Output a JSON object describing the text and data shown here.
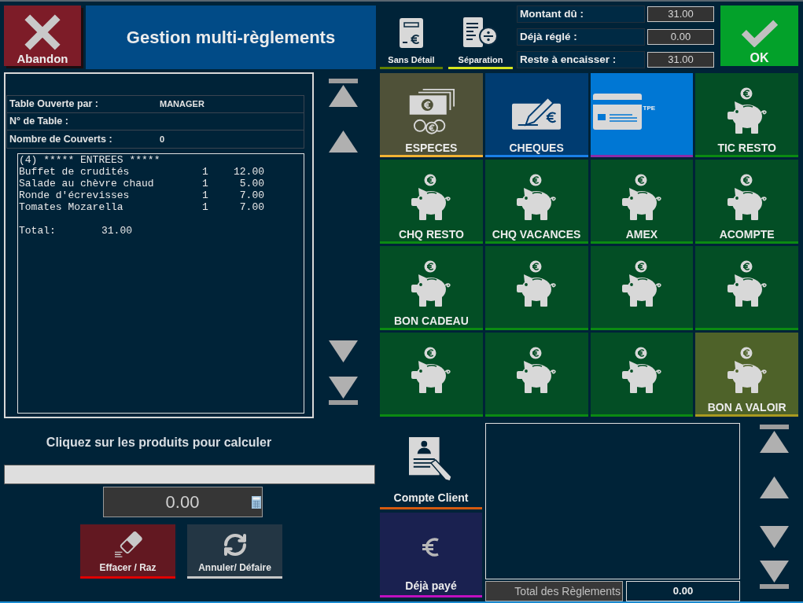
{
  "header": {
    "abandon_label": "Abandon",
    "title": "Gestion multi-règlements",
    "ticket_modes": [
      {
        "label": "Sans Détail",
        "kind": "receipt",
        "color": "#5f7f00"
      },
      {
        "label": "Séparation",
        "kind": "split",
        "color": "#d6e61e"
      }
    ],
    "amounts": [
      {
        "label": "Montant dû :",
        "value": "31.00"
      },
      {
        "label": "Déjà réglé :",
        "value": "0.00"
      },
      {
        "label": "Reste à encaisser :",
        "value": "31.00"
      }
    ],
    "ok_label": "OK"
  },
  "ticket": {
    "info": [
      {
        "label": "Table Ouverte par :",
        "value": "MANAGER"
      },
      {
        "label": "N° de Table :"
      },
      {
        "label": "Nombre de Couverts :",
        "value": "0"
      }
    ],
    "heading": "(4) ***** ENTREES *****",
    "lines": [
      {
        "name": "Buffet de crudités",
        "qty": "1",
        "price": "12.00"
      },
      {
        "name": "Salade au chèvre chaud",
        "qty": "1",
        "price": "5.00"
      },
      {
        "name": "Ronde d'écrevisses",
        "qty": "1",
        "price": "7.00"
      },
      {
        "name": "Tomates Mozarella",
        "qty": "1",
        "price": "7.00"
      }
    ],
    "total_label": "Total:",
    "total": "31.00"
  },
  "payment_methods": [
    {
      "label": "ESPECES",
      "kind": "cash",
      "color": "#4f5138"
    },
    {
      "label": "CHEQUES",
      "kind": "cheque",
      "color": "#003c71"
    },
    {
      "tag": "TPE",
      "kind": "card",
      "color": "#0077d4"
    },
    {
      "label": "TIC RESTO",
      "kind": "voucher",
      "color": "#034e25"
    },
    {
      "label": "CHQ RESTO",
      "kind": "voucher",
      "color": "#034e25"
    },
    {
      "label": "CHQ VACANCES",
      "kind": "voucher",
      "color": "#034e25"
    },
    {
      "label": "AMEX",
      "kind": "voucher",
      "color": "#034e25"
    },
    {
      "label": "ACOMPTE",
      "kind": "voucher",
      "color": "#034e25"
    },
    {
      "label": "BON CADEAU",
      "kind": "voucher",
      "color": "#034e25"
    },
    {
      "kind": "voucher",
      "color": "#034e25"
    },
    {
      "kind": "voucher",
      "color": "#034e25"
    },
    {
      "kind": "voucher",
      "color": "#034e25"
    },
    {
      "kind": "voucher",
      "color": "#034e25"
    },
    {
      "kind": "voucher",
      "color": "#034e25"
    },
    {
      "kind": "voucher",
      "color": "#034e25"
    },
    {
      "label": "BON A VALOIR",
      "kind": "credit",
      "color": "#4e6229"
    }
  ],
  "calculator": {
    "instruction": "Cliquez sur les produits pour calculer",
    "value": "0.00",
    "buttons": [
      {
        "label": "Effacer / Raz",
        "kind": "erase",
        "color": "#e00000"
      },
      {
        "label": "Annuler/ Défaire",
        "kind": "undo",
        "color": "#c8c8c8"
      }
    ]
  },
  "side_buttons": [
    {
      "label": "Compte Client",
      "kind": "account",
      "color": "#d45a10"
    },
    {
      "label": "Déjà payé",
      "kind": "paid",
      "color": "#c010c0"
    }
  ],
  "payments": {
    "total_label": "Total des Règlements",
    "total": "0.00"
  }
}
